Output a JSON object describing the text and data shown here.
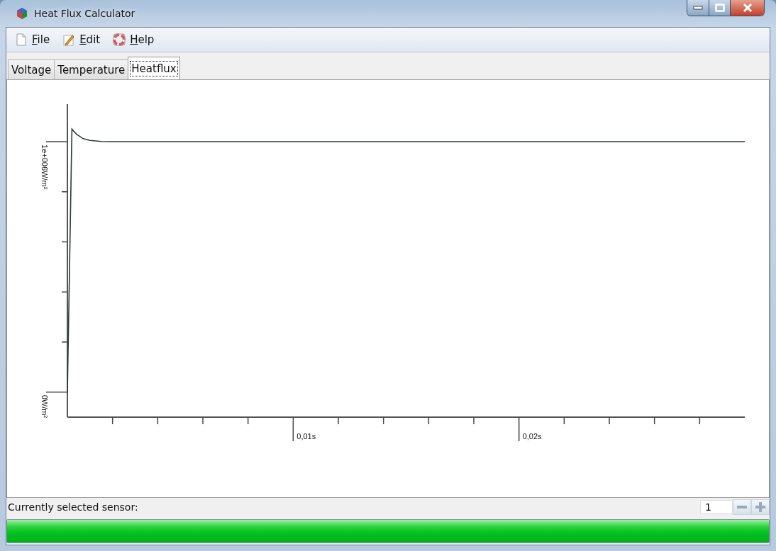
{
  "window": {
    "title": "Heat Flux Calculator"
  },
  "menu": [
    {
      "label": "File"
    },
    {
      "label": "Edit"
    },
    {
      "label": "Help"
    }
  ],
  "tabs": [
    {
      "label": "Voltage",
      "selected": false
    },
    {
      "label": "Temperature",
      "selected": false
    },
    {
      "label": "Heatflux",
      "selected": true
    }
  ],
  "chart": {
    "y_axis_labels": [
      "0W/m²",
      "1e+006W/m²"
    ],
    "x_axis_labels": [
      "0,01s",
      "0,02s"
    ]
  },
  "status": {
    "label": "Currently selected sensor:",
    "sensor_value": "1"
  },
  "progress": {
    "level": 1
  }
}
